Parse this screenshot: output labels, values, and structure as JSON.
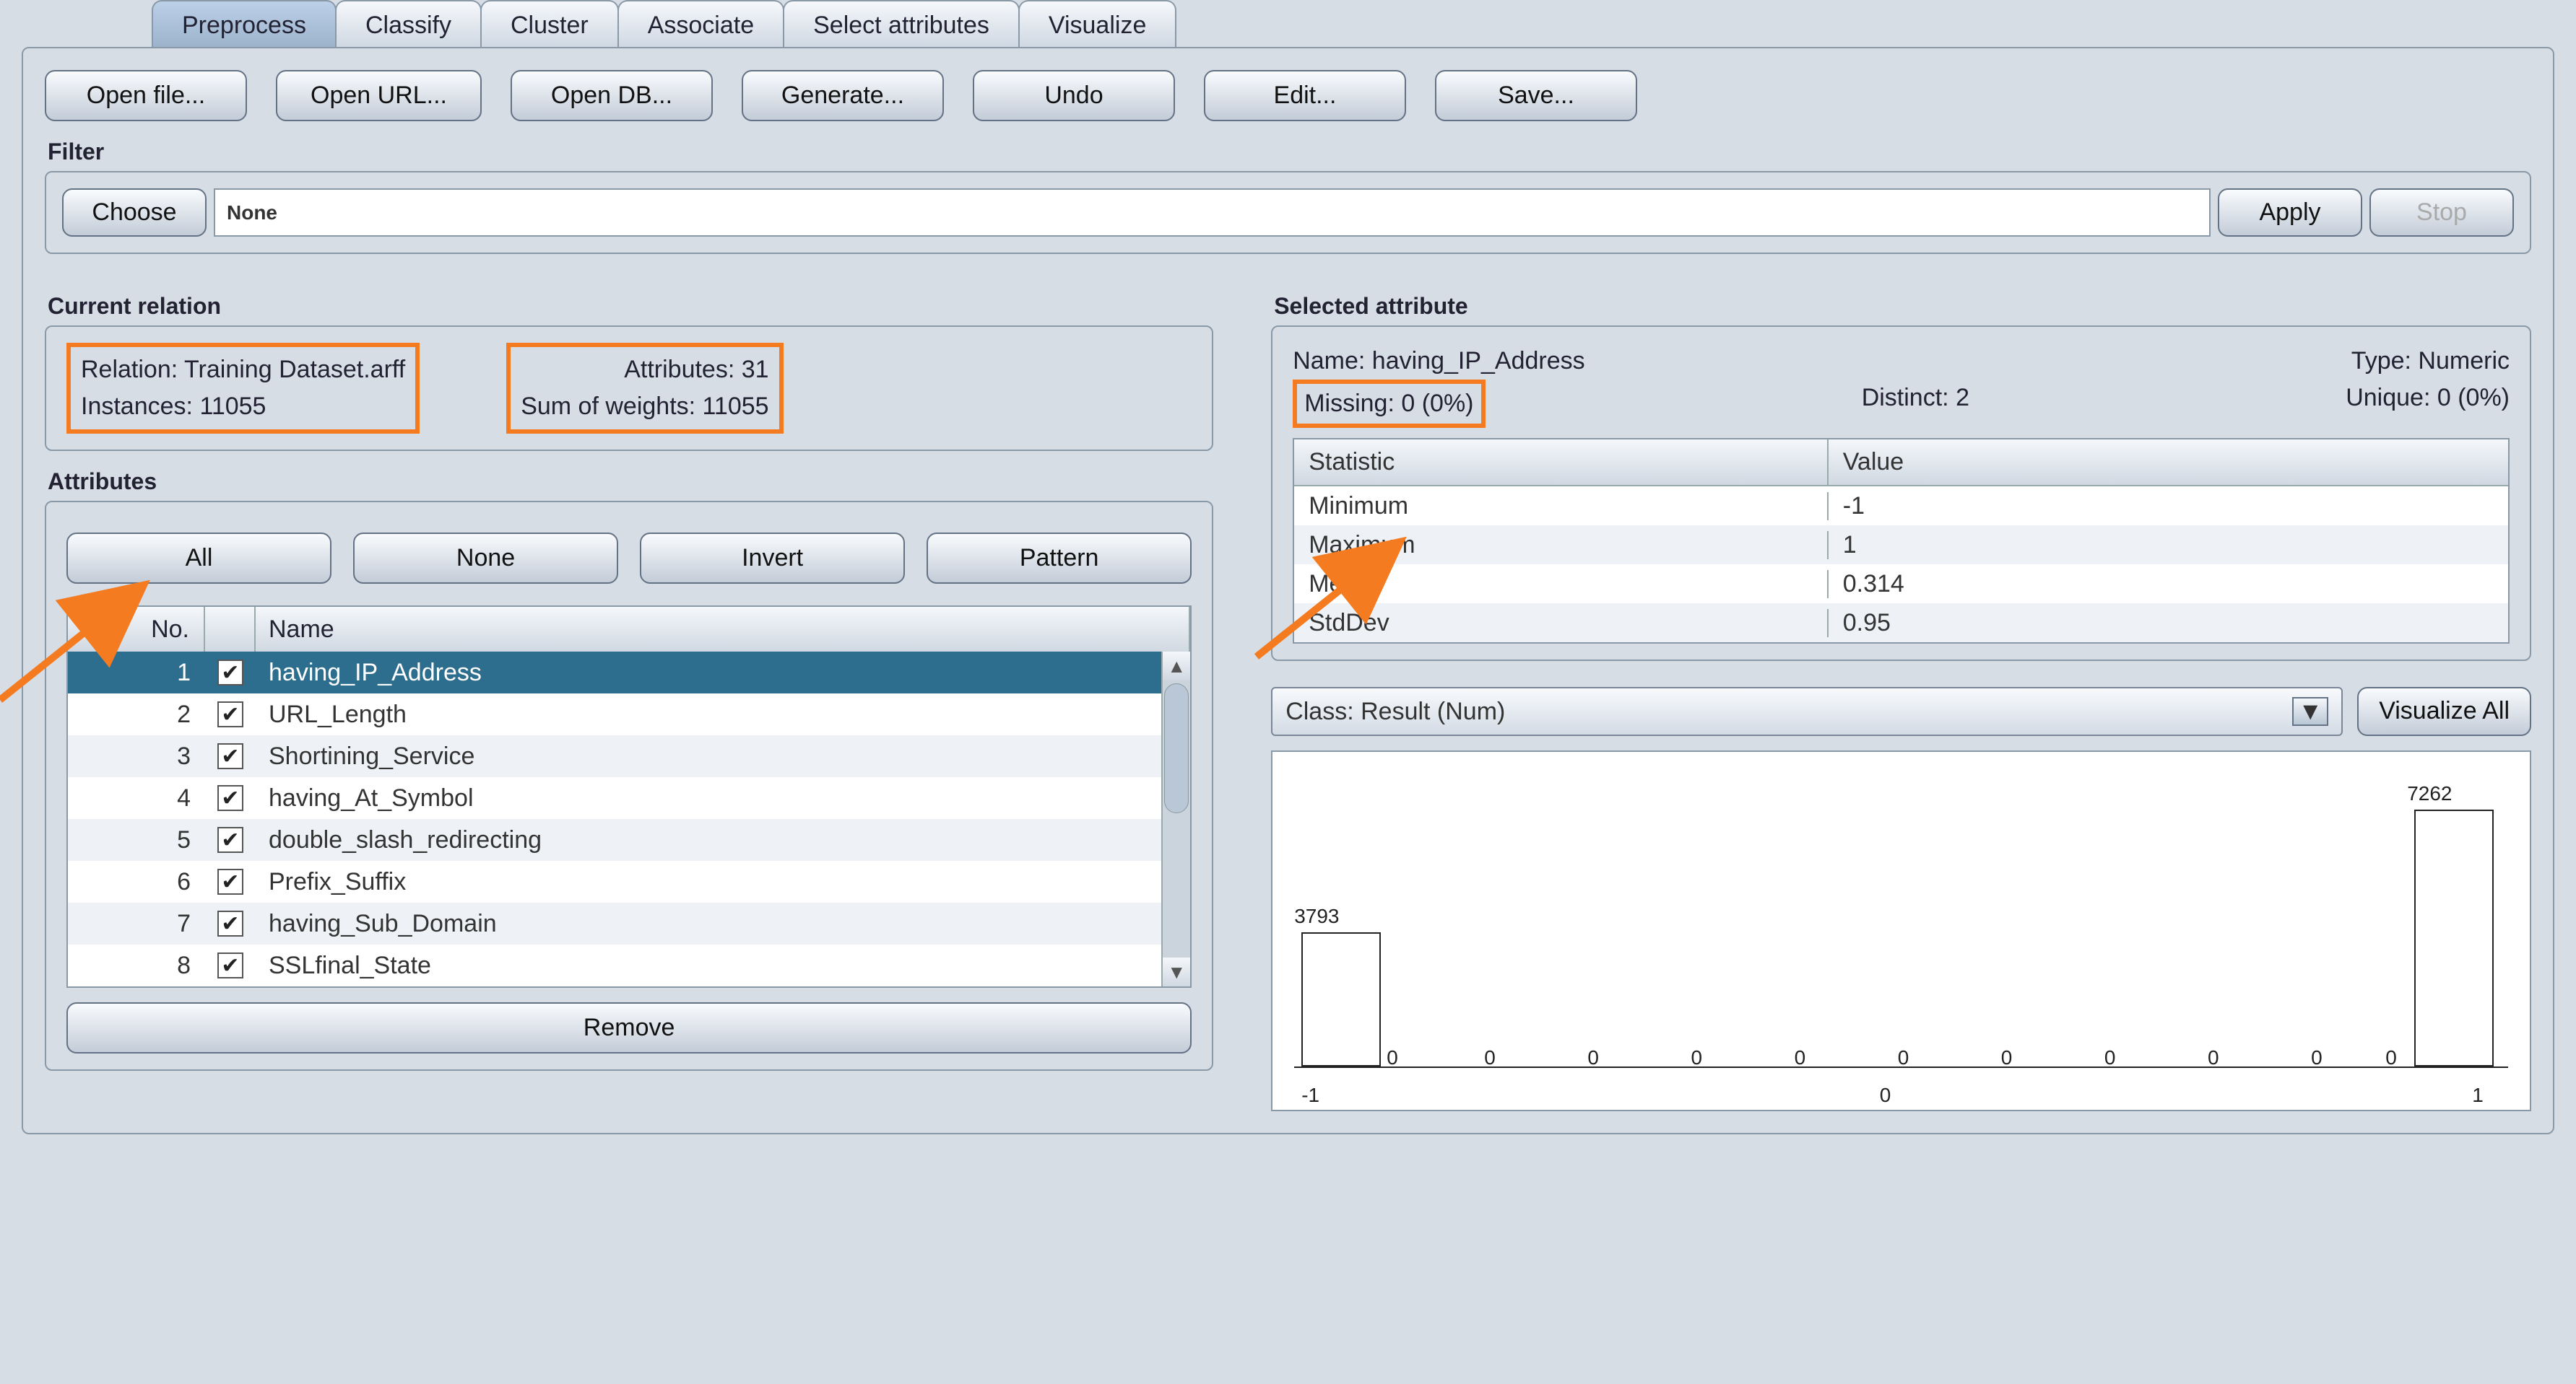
{
  "tabs": [
    "Preprocess",
    "Classify",
    "Cluster",
    "Associate",
    "Select attributes",
    "Visualize"
  ],
  "active_tab": 0,
  "toolbar": {
    "open_file": "Open file...",
    "open_url": "Open URL...",
    "open_db": "Open DB...",
    "generate": "Generate...",
    "undo": "Undo",
    "edit": "Edit...",
    "save": "Save..."
  },
  "filter": {
    "section": "Filter",
    "choose": "Choose",
    "value": "None",
    "apply": "Apply",
    "stop": "Stop"
  },
  "current_relation": {
    "section": "Current relation",
    "relation_label": "Relation:",
    "relation_value": "Training Dataset.arff",
    "instances_label": "Instances:",
    "instances_value": "11055",
    "attributes_label": "Attributes:",
    "attributes_value": "31",
    "sow_label": "Sum of weights:",
    "sow_value": "11055"
  },
  "attributes": {
    "section": "Attributes",
    "btn_all": "All",
    "btn_none": "None",
    "btn_invert": "Invert",
    "btn_pattern": "Pattern",
    "hdr_no": "No.",
    "hdr_name": "Name",
    "rows": [
      {
        "no": "1",
        "name": "having_IP_Address"
      },
      {
        "no": "2",
        "name": "URL_Length"
      },
      {
        "no": "3",
        "name": "Shortining_Service"
      },
      {
        "no": "4",
        "name": "having_At_Symbol"
      },
      {
        "no": "5",
        "name": "double_slash_redirecting"
      },
      {
        "no": "6",
        "name": "Prefix_Suffix"
      },
      {
        "no": "7",
        "name": "having_Sub_Domain"
      },
      {
        "no": "8",
        "name": "SSLfinal_State"
      }
    ],
    "remove": "Remove"
  },
  "selected_attribute": {
    "section": "Selected attribute",
    "name_label": "Name:",
    "name_value": "having_IP_Address",
    "type_label": "Type:",
    "type_value": "Numeric",
    "missing_label": "Missing:",
    "missing_value": "0 (0%)",
    "distinct_label": "Distinct:",
    "distinct_value": "2",
    "unique_label": "Unique:",
    "unique_value": "0 (0%)",
    "stat_hdr": "Statistic",
    "val_hdr": "Value",
    "stats": [
      {
        "k": "Minimum",
        "v": "-1"
      },
      {
        "k": "Maximum",
        "v": "1"
      },
      {
        "k": "Mean",
        "v": "0.314"
      },
      {
        "k": "StdDev",
        "v": "0.95"
      }
    ]
  },
  "class_select": {
    "value": "Class: Result (Num)",
    "viz_all": "Visualize All"
  },
  "chart_data": {
    "type": "bar",
    "categories": [
      "-1",
      "1"
    ],
    "values": [
      3793,
      7262
    ],
    "xlabel": "",
    "ylabel": "",
    "xlim": [
      -1,
      1
    ],
    "axis_ticks": [
      "-1",
      "0",
      "1"
    ],
    "zero_markers_count": 10
  }
}
